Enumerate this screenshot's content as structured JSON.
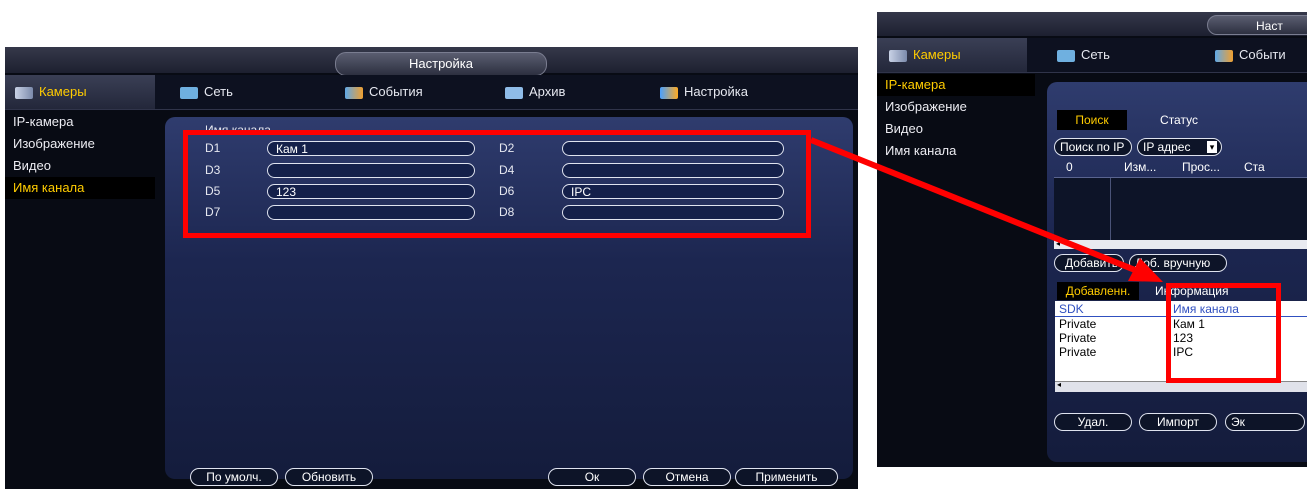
{
  "left": {
    "title": "Настройка",
    "tabs": [
      {
        "label": "Камеры"
      },
      {
        "label": "Сеть"
      },
      {
        "label": "События"
      },
      {
        "label": "Архив"
      },
      {
        "label": "Настройка"
      }
    ],
    "sidebar": [
      {
        "label": "IP-камера"
      },
      {
        "label": "Изображение"
      },
      {
        "label": "Видео"
      },
      {
        "label": "Имя канала"
      }
    ],
    "section_title": "Имя канала",
    "channels": [
      {
        "label": "D1",
        "value": "Кам 1"
      },
      {
        "label": "D2",
        "value": ""
      },
      {
        "label": "D3",
        "value": ""
      },
      {
        "label": "D4",
        "value": ""
      },
      {
        "label": "D5",
        "value": "123"
      },
      {
        "label": "D6",
        "value": "IPC"
      },
      {
        "label": "D7",
        "value": ""
      },
      {
        "label": "D8",
        "value": ""
      }
    ],
    "buttons": {
      "default": "По умолч.",
      "refresh": "Обновить",
      "ok": "Ок",
      "cancel": "Отмена",
      "apply": "Применить"
    }
  },
  "right": {
    "title": "Наст",
    "tabs": [
      {
        "label": "Камеры"
      },
      {
        "label": "Сеть"
      },
      {
        "label": "Событи"
      }
    ],
    "sidebar": [
      {
        "label": "IP-камера"
      },
      {
        "label": "Изображение"
      },
      {
        "label": "Видео"
      },
      {
        "label": "Имя канала"
      }
    ],
    "subtabs": [
      {
        "label": "Поиск"
      },
      {
        "label": "Статус"
      }
    ],
    "search_button": "Поиск по IP",
    "filter_select": "IP адрес",
    "search_columns": [
      "0",
      "Изм...",
      "Прос...",
      "Ста"
    ],
    "add_button": "Добавить",
    "manual_add_button": "Доб. вручную",
    "lower_tabs": [
      {
        "label": "Добавленн."
      },
      {
        "label": "Информация"
      }
    ],
    "device_columns": [
      "SDK",
      "Имя канала"
    ],
    "devices": [
      {
        "sdk": "Private",
        "name": "Кам 1"
      },
      {
        "sdk": "Private",
        "name": "123"
      },
      {
        "sdk": "Private",
        "name": "IPC"
      }
    ],
    "delete_button": "Удал.",
    "import_button": "Импорт",
    "export_button": "Эк"
  },
  "colors": {
    "accent": "#ffcc00",
    "highlight": "#ff0000",
    "background": "#080b14"
  }
}
